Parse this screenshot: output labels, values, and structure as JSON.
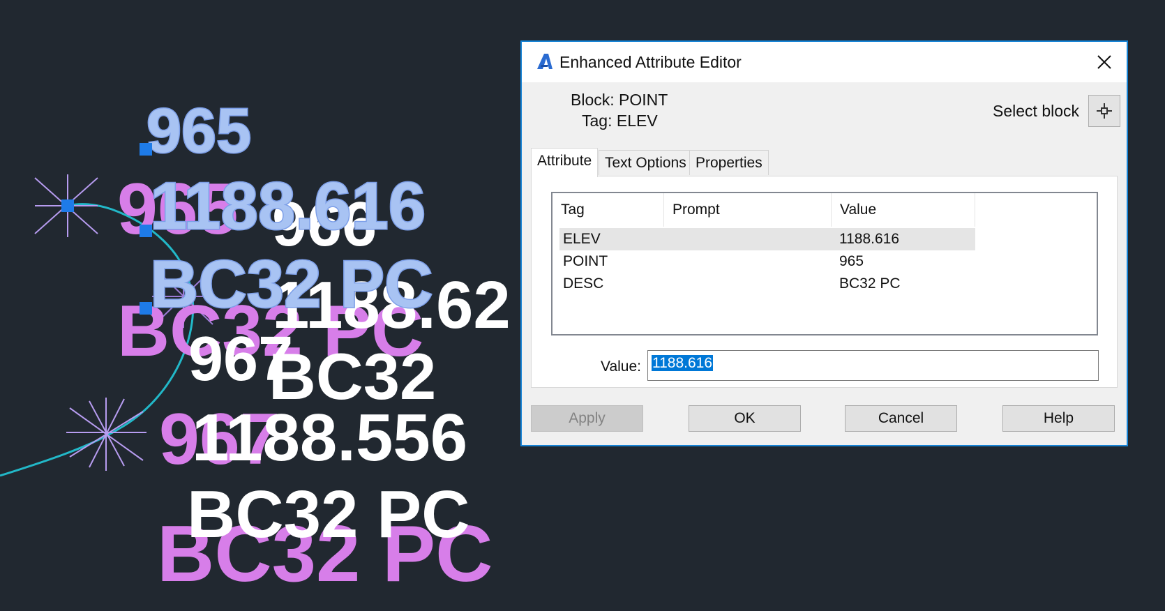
{
  "canvas": {
    "text_items": [
      {
        "id": "cad-965-blue",
        "text": "965",
        "color": "#a8c3f3"
      },
      {
        "id": "cad-1188616-blue",
        "text": "1188.616",
        "color": "#a8c3f3"
      },
      {
        "id": "cad-bc32pc-blue",
        "text": "BC32 PC",
        "color": "#a8c3f3"
      },
      {
        "id": "cad-965-magenta",
        "text": "965",
        "color": "#d77ee9"
      },
      {
        "id": "cad-bc32pc-magenta-1",
        "text": "BC32 PC",
        "color": "#d77ee9"
      },
      {
        "id": "cad-967-magenta",
        "text": "967",
        "color": "#d77ee9"
      },
      {
        "id": "cad-bc32pc-magenta-2",
        "text": "BC32 PC",
        "color": "#d77ee9"
      },
      {
        "id": "cad-966-white",
        "text": "966",
        "color": "#ffffff"
      },
      {
        "id": "cad-1188-62-white",
        "text": "1188.62",
        "color": "#ffffff"
      },
      {
        "id": "cad-967-white",
        "text": "967",
        "color": "#ffffff"
      },
      {
        "id": "cad-bc32-white",
        "text": "BC32",
        "color": "#ffffff"
      },
      {
        "id": "cad-1188556-white",
        "text": "1188.556",
        "color": "#ffffff"
      },
      {
        "id": "cad-bc32pc-white",
        "text": "BC32 PC",
        "color": "#ffffff"
      }
    ],
    "colors": {
      "background": "#212830",
      "polyline": "#22b8c8",
      "grip": "#1e7be8"
    }
  },
  "dialog": {
    "title": "Enhanced Attribute Editor",
    "app_icon": "autocad-a-icon",
    "close_icon": "close-icon",
    "block_label": "Block:",
    "block_value": "POINT",
    "tag_label": "Tag:",
    "tag_value": "ELEV",
    "select_block_label": "Select block",
    "select_block_icon": "crosshair-pick-icon",
    "tabs": [
      {
        "label": "Attribute",
        "active": true
      },
      {
        "label": "Text Options",
        "active": false
      },
      {
        "label": "Properties",
        "active": false
      }
    ],
    "list": {
      "columns": [
        "Tag",
        "Prompt",
        "Value"
      ],
      "rows": [
        {
          "tag": "ELEV",
          "prompt": "",
          "value": "1188.616",
          "selected": true
        },
        {
          "tag": "POINT",
          "prompt": "",
          "value": "965",
          "selected": false
        },
        {
          "tag": "DESC",
          "prompt": "",
          "value": "BC32 PC",
          "selected": false
        }
      ]
    },
    "value_label": "Value:",
    "value_text": "1188.616",
    "buttons": {
      "apply": "Apply",
      "ok": "OK",
      "cancel": "Cancel",
      "help": "Help"
    }
  }
}
